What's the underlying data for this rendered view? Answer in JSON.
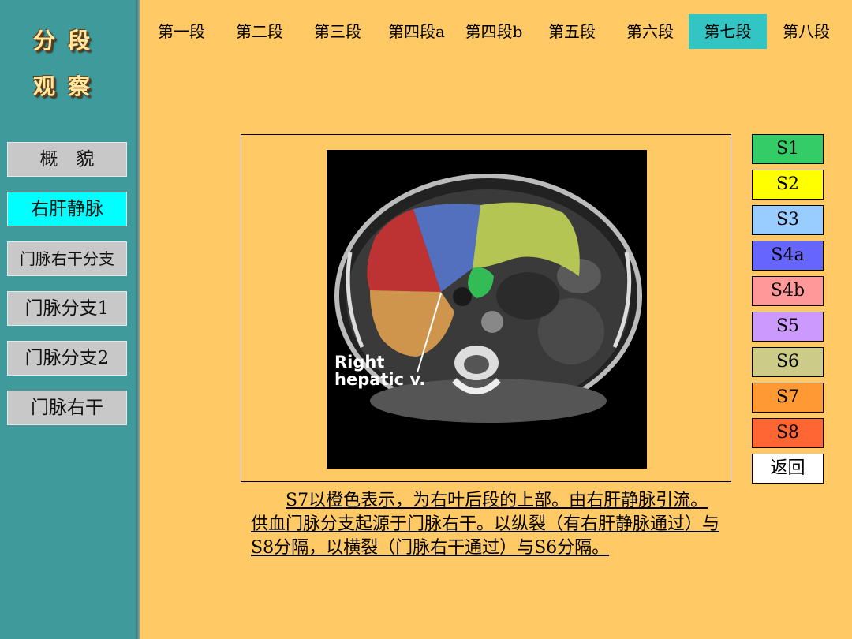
{
  "sidebar": {
    "title_line1": "分段",
    "title_line2": "观察",
    "buttons": [
      {
        "label": "概　貌"
      },
      {
        "label": "右肝静脉"
      },
      {
        "label": "门脉右干分支"
      },
      {
        "label": "门脉分支1"
      },
      {
        "label": "门脉分支2"
      },
      {
        "label": "门脉右干"
      }
    ]
  },
  "tabs": [
    {
      "label": "第一段"
    },
    {
      "label": "第二段"
    },
    {
      "label": "第三段"
    },
    {
      "label": "第四段a"
    },
    {
      "label": "第四段b"
    },
    {
      "label": "第五段"
    },
    {
      "label": "第六段"
    },
    {
      "label": "第七段"
    },
    {
      "label": "第八段"
    }
  ],
  "active_tab": "第七段",
  "image": {
    "annotation_line1": "Right",
    "annotation_line2": "hepatic v."
  },
  "segments": [
    {
      "label": "S1",
      "color": "#33cc66"
    },
    {
      "label": "S2",
      "color": "#ffff00"
    },
    {
      "label": "S3",
      "color": "#99ccff"
    },
    {
      "label": "S4a",
      "color": "#6666ff"
    },
    {
      "label": "S4b",
      "color": "#ff9999"
    },
    {
      "label": "S5",
      "color": "#cc99ff"
    },
    {
      "label": "S6",
      "color": "#cccc88"
    },
    {
      "label": "S7",
      "color": "#ff9933"
    },
    {
      "label": "S8",
      "color": "#ff6633"
    },
    {
      "label": "返回",
      "color": "#ffffff"
    }
  ],
  "caption": "S7以橙色表示，为右叶后段的上部。由右肝静脉引流。供血门脉分支起源于门脉右干。以纵裂（有右肝静脉通过）与S8分隔，以横裂（门脉右干通过）与S6分隔。"
}
